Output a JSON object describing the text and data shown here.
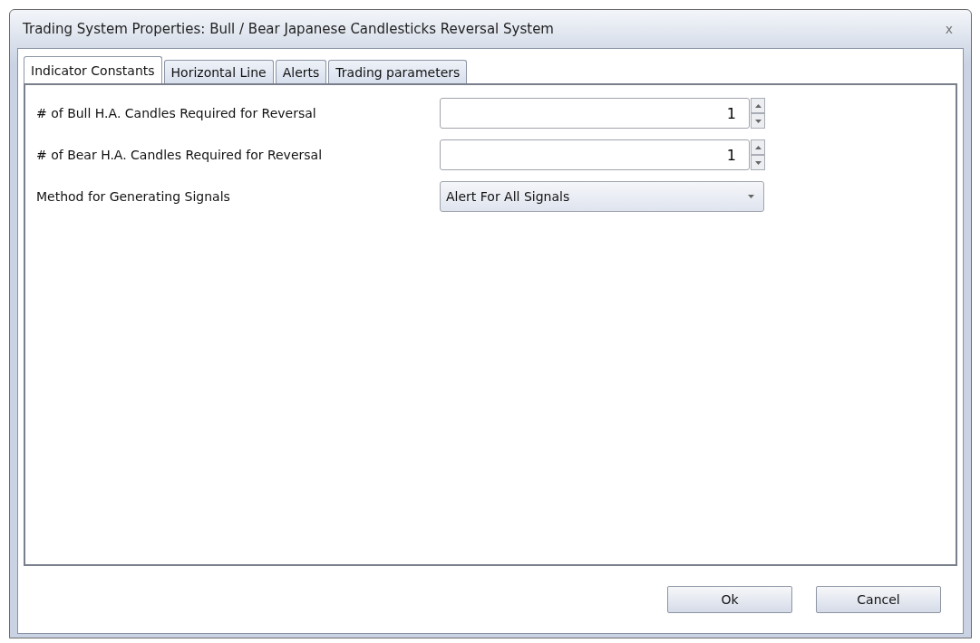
{
  "window": {
    "title": "Trading System Properties: Bull / Bear Japanese Candlesticks Reversal System",
    "close": "x"
  },
  "tabs": [
    {
      "label": "Indicator Constants",
      "selected": true
    },
    {
      "label": "Horizontal Line",
      "selected": false
    },
    {
      "label": "Alerts",
      "selected": false
    },
    {
      "label": "Trading parameters",
      "selected": false
    }
  ],
  "fields": [
    {
      "kind": "spinner",
      "label": "# of Bull H.A. Candles Required for Reversal",
      "value": "1"
    },
    {
      "kind": "spinner",
      "label": "# of Bear H.A. Candles Required for Reversal",
      "value": "1"
    },
    {
      "kind": "dropdown",
      "label": "Method for Generating Signals",
      "value": "Alert For All Signals"
    }
  ],
  "buttons": [
    "Ok",
    "Cancel"
  ]
}
